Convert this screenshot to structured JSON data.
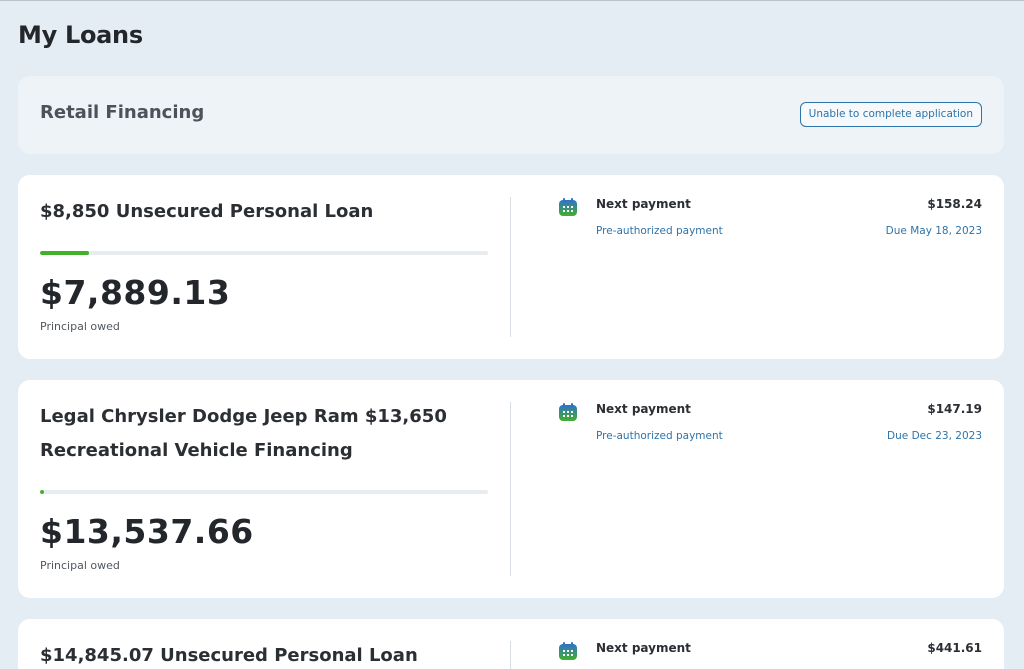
{
  "page": {
    "title": "My Loans"
  },
  "section": {
    "title": "Retail Financing",
    "status": "Unable to complete application"
  },
  "loans": [
    {
      "title": "$8,850 Unsecured Personal Loan",
      "progress_percent": 11,
      "amount": "$7,889.13",
      "amount_label": "Principal owed",
      "next_label": "Next payment",
      "payment_type": "Pre-authorized payment",
      "payment_amount": "$158.24",
      "due": "Due May 18, 2023"
    },
    {
      "title": "Legal Chrysler Dodge Jeep Ram $13,650 Recreational Vehicle Financing",
      "progress_percent": 1,
      "amount": "$13,537.66",
      "amount_label": "Principal owed",
      "next_label": "Next payment",
      "payment_type": "Pre-authorized payment",
      "payment_amount": "$147.19",
      "due": "Due Dec 23, 2023"
    },
    {
      "title": "$14,845.07 Unsecured Personal Loan",
      "next_label": "Next payment",
      "payment_amount": "$441.61"
    }
  ],
  "icons": {
    "payment": "calendar-icon"
  },
  "colors": {
    "accent": "#2f73a8",
    "progress": "#43b02a",
    "background": "#e4edf4"
  }
}
